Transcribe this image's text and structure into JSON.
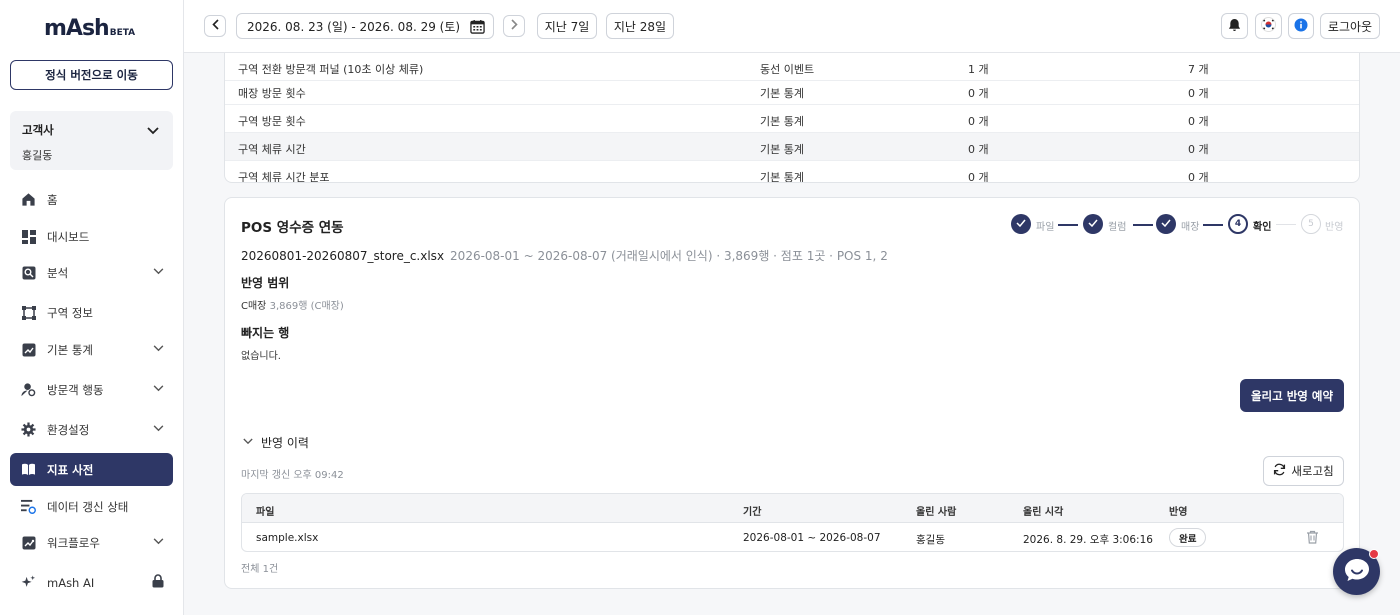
{
  "app": {
    "logo": "mAsh",
    "logo_badge": "BETA"
  },
  "sidebar": {
    "official_button": "정식 버전으로 이동",
    "account": {
      "company": "고객사",
      "user": "홍길동"
    },
    "items": [
      {
        "label": "홈",
        "icon": "home-icon"
      },
      {
        "label": "대시보드",
        "icon": "dashboard-icon"
      },
      {
        "label": "분석",
        "icon": "analysis-icon"
      },
      {
        "label": "구역 정보",
        "icon": "zone-icon"
      },
      {
        "label": "기본 통계",
        "icon": "chart-line-icon"
      },
      {
        "label": "방문객 행동",
        "icon": "visitor-icon"
      },
      {
        "label": "환경설정",
        "icon": "gear-icon"
      },
      {
        "label": "지표 사전",
        "icon": "book-icon"
      },
      {
        "label": "데이터 갱신 상태",
        "icon": "data-status-icon"
      },
      {
        "label": "워크플로우",
        "icon": "workflow-icon"
      },
      {
        "label": "mAsh AI",
        "icon": "sparkle-icon"
      }
    ]
  },
  "topbar": {
    "date_range": "2026. 08. 23 (일) - 2026. 08. 29 (토)",
    "last7": "지난 7일",
    "last28": "지난 28일",
    "logout": "로그아웃"
  },
  "metric_rows": [
    {
      "name": "구역 전환 방문객 퍼널 (10초 이상 체류)",
      "category": "동선 이벤트",
      "a": "1 개",
      "b": "7 개"
    },
    {
      "name": "매장 방문 횟수",
      "category": "기본 통계",
      "a": "0 개",
      "b": "0 개"
    },
    {
      "name": "구역 방문 횟수",
      "category": "기본 통계",
      "a": "0 개",
      "b": "0 개"
    },
    {
      "name": "구역 체류 시간",
      "category": "기본 통계",
      "a": "0 개",
      "b": "0 개"
    },
    {
      "name": "구역 체류 시간 분포",
      "category": "기본 통계",
      "a": "0 개",
      "b": "0 개"
    }
  ],
  "pos": {
    "title": "POS 영수증 연동",
    "steps": [
      {
        "num": "1",
        "label": "파일"
      },
      {
        "num": "2",
        "label": "컬럼"
      },
      {
        "num": "3",
        "label": "매장"
      },
      {
        "num": "4",
        "label": "확인"
      },
      {
        "num": "5",
        "label": "반영"
      }
    ],
    "file_name": "20260801-20260807_store_c.xlsx",
    "file_meta": "2026-08-01 ~ 2026-08-07 (거래일시에서 인식) · 3,869행 · 점포 1곳 · POS 1, 2",
    "scope_title": "반영 범위",
    "scope_store": "C매장",
    "scope_detail": "3,869행 (C매장)",
    "excluded_title": "빠지는 행",
    "excluded_text": "없습니다.",
    "reserve_button": "올리고 반영 예약",
    "history_title": "반영 이력",
    "last_update": "마지막 갱신 오후 09:42",
    "refresh_button": "새로고침",
    "history_headers": {
      "file": "파일",
      "period": "기간",
      "uploader": "올린 사람",
      "uploaded_at": "올린 시각",
      "status": "반영"
    },
    "history_rows": [
      {
        "file": "sample.xlsx",
        "period": "2026-08-01 ~ 2026-08-07",
        "uploader": "홍길동",
        "uploaded_at": "2026. 8. 29. 오후 3:06:16",
        "status": "완료"
      }
    ],
    "total": "전체 1건"
  },
  "colors": {
    "primary": "#2e3766",
    "notification_dot": "#e53945",
    "info": "#1a73e8"
  }
}
